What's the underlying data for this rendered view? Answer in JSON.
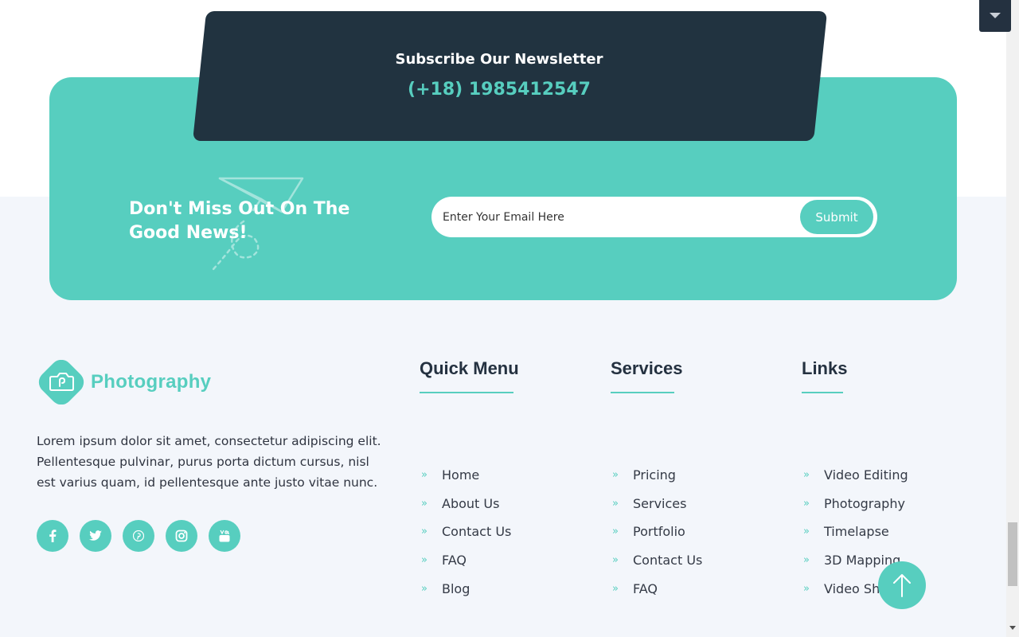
{
  "newsletter": {
    "title": "Subscribe Our Newsletter",
    "phone": "(+18) 1985412547"
  },
  "subscribe": {
    "heading": "Don't Miss Out On The Good News!",
    "email_placeholder": "Enter Your Email Here",
    "submit_label": "Submit"
  },
  "brand": {
    "logo_text": "Photography",
    "about": "Lorem ipsum dolor sit amet, consectetur adipiscing elit. Pellentesque pulvinar, purus porta dictum cursus, nisl est varius quam, id pellentesque ante justo vitae nunc."
  },
  "social_icons": [
    "facebook-icon",
    "twitter-icon",
    "pinterest-icon",
    "instagram-icon",
    "youtube-icon"
  ],
  "columns": {
    "quick_menu": {
      "title": "Quick Menu",
      "items": [
        "Home",
        "About Us",
        "Contact Us",
        "FAQ",
        "Blog"
      ]
    },
    "services": {
      "title": "Services",
      "items": [
        "Pricing",
        "Services",
        "Portfolio",
        "Contact Us",
        "FAQ"
      ]
    },
    "links": {
      "title": "Links",
      "items": [
        "Video Editing",
        "Photography",
        "Timelapse",
        "3D Mapping",
        "Video Shooting"
      ]
    }
  },
  "colors": {
    "accent": "#57cebf",
    "dark": "#213340",
    "background": "#f3f6fb"
  }
}
